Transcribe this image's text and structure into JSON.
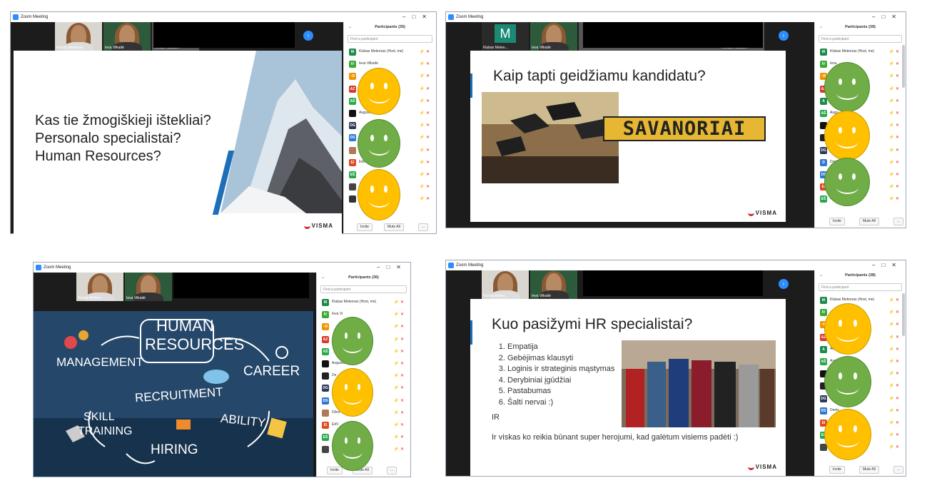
{
  "window_title": "Zoom Meeting",
  "panel": {
    "search_placeholder": "Find a participant",
    "invite": "Invite",
    "mute_all": "Mute All",
    "more": "..."
  },
  "windows": [
    {
      "participants_title": "Participants (35)",
      "thumb_names": [
        "Klubas Meteoras",
        "Ieva Vilkaitė",
        "Renata Kazlau..."
      ],
      "slide_lines": [
        "Kas tie žmogiškieji ištekliai?",
        "Personalo specialistai?",
        "Human Resources?"
      ],
      "participants": [
        {
          "initials": "M",
          "color": "#1f8a4c",
          "name": "Klubas Meteoras (Host, me)"
        },
        {
          "initials": "IV",
          "color": "#3aaa35",
          "name": "Ieva Vilkaitė"
        },
        {
          "initials": "~D",
          "color": "#f29400",
          "name": ""
        },
        {
          "initials": "AZ",
          "color": "#d93a2b",
          "name": ""
        },
        {
          "initials": "AŠ",
          "color": "#27a84a",
          "name": ""
        },
        {
          "initials": "",
          "color": "#111111",
          "name": "Augustė"
        },
        {
          "initials": "DG",
          "color": "#2b3a55",
          "name": ""
        },
        {
          "initials": "DS",
          "color": "#2e77d0",
          "name": ""
        },
        {
          "initials": "",
          "color": "#b07a5a",
          "name": "Džes"
        },
        {
          "initials": "EI",
          "color": "#e0491f",
          "name": "Edvi"
        },
        {
          "initials": "EŠ",
          "color": "#27a84a",
          "name": ""
        },
        {
          "initials": "",
          "color": "#444444",
          "name": ""
        },
        {
          "initials": "",
          "color": "#333333",
          "name": "Elen"
        }
      ]
    },
    {
      "participants_title": "Participants (39)",
      "thumb_names": [
        "Klubas Meteo...",
        "Ieva Vilkaitė",
        "Renata Kazlau..."
      ],
      "thumb_initial": "M",
      "slide_title": "Kaip tapti geidžiamu kandidatu?",
      "sign_word": "SAVANORIAI",
      "participants": [
        {
          "initials": "M",
          "color": "#1f8a4c",
          "name": "Klubas Meteoras (Host, me)"
        },
        {
          "initials": "IV",
          "color": "#3aaa35",
          "name": "Ieva"
        },
        {
          "initials": "~D",
          "color": "#f29400",
          "name": ""
        },
        {
          "initials": "AZ",
          "color": "#d93a2b",
          "name": ""
        },
        {
          "initials": "A",
          "color": "#1f8a4c",
          "name": "Audr"
        },
        {
          "initials": "AŠ",
          "color": "#27a84a",
          "name": "Augu"
        },
        {
          "initials": "",
          "color": "#111111",
          "name": ""
        },
        {
          "initials": "",
          "color": "#222222",
          "name": ""
        },
        {
          "initials": "DG",
          "color": "#2b3a55",
          "name": "Deni"
        },
        {
          "initials": "D",
          "color": "#2e77d0",
          "name": "Don"
        },
        {
          "initials": "DS",
          "color": "#2e77d0",
          "name": ""
        },
        {
          "initials": "EI",
          "color": "#e0491f",
          "name": ""
        },
        {
          "initials": "EŠ",
          "color": "#27a84a",
          "name": "Edvin"
        }
      ]
    },
    {
      "participants_title": "Participants (36)",
      "thumb_names": [
        "Klubas Meteor...",
        "Ieva Vilkaitė"
      ],
      "hr_words": {
        "title1": "HUMAN",
        "title2": "RESOURCES",
        "management": "MANAGEMENT",
        "career": "CAREER",
        "recruitment": "RECRUITMENT",
        "skill": "SKILL",
        "training": "TRAINING",
        "ability": "ABILITY",
        "hiring": "HIRING"
      },
      "participants": [
        {
          "initials": "M",
          "color": "#1f8a4c",
          "name": "Klubas Meteoras (Host, me)"
        },
        {
          "initials": "IV",
          "color": "#3aaa35",
          "name": "Ieva Vi"
        },
        {
          "initials": "~D",
          "color": "#f29400",
          "name": ""
        },
        {
          "initials": "AZ",
          "color": "#d93a2b",
          "name": ""
        },
        {
          "initials": "AŠ",
          "color": "#27a84a",
          "name": ""
        },
        {
          "initials": "",
          "color": "#111111",
          "name": "Augustė Bertulytė"
        },
        {
          "initials": "",
          "color": "#222222",
          "name": "De"
        },
        {
          "initials": "DG",
          "color": "#2b3a55",
          "name": ""
        },
        {
          "initials": "DS",
          "color": "#2e77d0",
          "name": ""
        },
        {
          "initials": "",
          "color": "#b07a5a",
          "name": "Džes"
        },
        {
          "initials": "EI",
          "color": "#e0491f",
          "name": "EdV"
        },
        {
          "initials": "EŠ",
          "color": "#27a84a",
          "name": ""
        },
        {
          "initials": "",
          "color": "#444444",
          "name": ""
        }
      ]
    },
    {
      "participants_title": "Participants (38)",
      "thumb_names": [
        "Klubas Meteo...",
        "Ieva Vilkaitė"
      ],
      "slide_title": "Kuo pasižymi HR specialistai?",
      "list": [
        "Empatija",
        "Gebėjimas klausyti",
        "Loginis ir strateginis mąstymas",
        "Derybiniai įgūdžiai",
        "Pastabumas",
        "Šalti nervai :)"
      ],
      "ir": "IR",
      "footer_line": "Ir viskas ko reikia būnant super herojumi, kad galėtum visiems padėti :)",
      "participants": [
        {
          "initials": "M",
          "color": "#1f8a4c",
          "name": "Klubas Meteoras (Host, me)"
        },
        {
          "initials": "IV",
          "color": "#3aaa35",
          "name": ""
        },
        {
          "initials": "~D",
          "color": "#f29400",
          "name": ""
        },
        {
          "initials": "AZ",
          "color": "#d93a2b",
          "name": ""
        },
        {
          "initials": "A",
          "color": "#1f8a4c",
          "name": "Audrė Igaraitė"
        },
        {
          "initials": "AŠ",
          "color": "#27a84a",
          "name": "Aug"
        },
        {
          "initials": "",
          "color": "#111111",
          "name": ""
        },
        {
          "initials": "",
          "color": "#222222",
          "name": ""
        },
        {
          "initials": "DG",
          "color": "#2b3a55",
          "name": "Deni"
        },
        {
          "initials": "DS",
          "color": "#2e77d0",
          "name": "Denis"
        },
        {
          "initials": "EI",
          "color": "#e0491f",
          "name": ""
        },
        {
          "initials": "EŠ",
          "color": "#27a84a",
          "name": ""
        },
        {
          "initials": "",
          "color": "#444444",
          "name": "Ethi"
        }
      ]
    }
  ],
  "brand": "VISMA",
  "colors": {
    "smiley_yellow": "#ffc000",
    "smiley_green": "#70ad47",
    "zoom_blue": "#2d8cff"
  }
}
